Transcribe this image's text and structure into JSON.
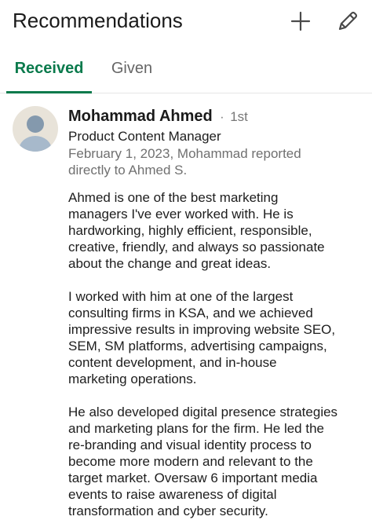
{
  "header": {
    "title": "Recommendations",
    "add_icon": "plus-icon",
    "edit_icon": "pencil-icon"
  },
  "tabs": [
    {
      "label": "Received",
      "active": true
    },
    {
      "label": "Given",
      "active": false
    }
  ],
  "colors": {
    "accent": "#0a7a4c",
    "muted_text": "#707070"
  },
  "recommendation": {
    "name": "Mohammad Ahmed",
    "separator": "·",
    "degree": "1st",
    "headline": "Product Content Manager",
    "relation_lines": [
      "February 1, 2023, Mohammad reported",
      "directly to Ahmed S."
    ],
    "paragraphs": [
      [
        "Ahmed is one of the best marketing",
        "managers I've ever worked with. He is",
        "hardworking, highly efficient, responsible,",
        "creative, friendly, and always so passionate",
        "about the change and great ideas."
      ],
      [
        "I worked with him at one of the largest",
        "consulting firms in KSA, and we achieved",
        "impressive results in improving website SEO,",
        "SEM, SM platforms, advertising campaigns,",
        "content development, and in-house",
        "marketing operations."
      ],
      [
        "He also developed digital presence strategies",
        "and marketing plans for the firm. He led the",
        "re-branding and visual identity process to",
        "become more modern and relevant to the",
        "target market. Oversaw 6 important media",
        "events to raise awareness of digital",
        "transformation and cyber security."
      ]
    ]
  }
}
